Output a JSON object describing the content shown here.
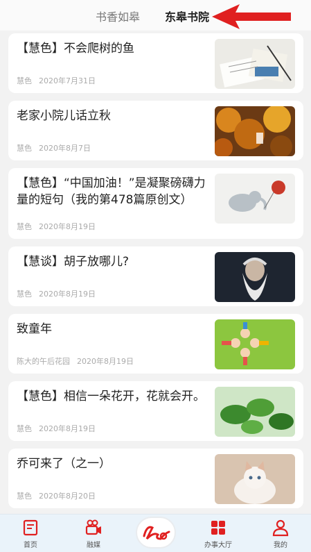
{
  "header": {
    "tabs": [
      {
        "label": "书香如皋"
      },
      {
        "label": "东皋书院"
      }
    ]
  },
  "articles": [
    {
      "title": "【慧色】不会爬树的鱼",
      "author": "慧色",
      "date": "2020年7月31日",
      "thumb": "notebook-photo"
    },
    {
      "title": "老家小院儿话立秋",
      "author": "慧色",
      "date": "2020年8月7日",
      "thumb": "autumn-leaves-photo"
    },
    {
      "title": "【慧色】“中国加油！”是凝聚磅礴力量的短句（我的第478篇原创文）",
      "author": "慧色",
      "date": "2020年8月19日",
      "thumb": "elephant-drawing"
    },
    {
      "title": "【慧谈】胡子放哪儿?",
      "author": "慧色",
      "date": "2020年8月19日",
      "thumb": "bearded-man-photo"
    },
    {
      "title": "致童年",
      "author": "陈大的午后花园",
      "date": "2020年8月19日",
      "thumb": "children-cartoon"
    },
    {
      "title": "【慧色】相信一朵花开，花就会开。",
      "author": "慧色",
      "date": "2020年8月19日",
      "thumb": "green-leaves-photo"
    },
    {
      "title": "乔可来了（之一）",
      "author": "慧色",
      "date": "2020年8月20日",
      "thumb": "kitten-photo"
    }
  ],
  "nav": {
    "items": [
      {
        "label": "首页",
        "icon": "home-icon"
      },
      {
        "label": "融媒",
        "icon": "video-camera-icon"
      },
      {
        "label": "办事大厅",
        "icon": "grid-icon"
      },
      {
        "label": "我的",
        "icon": "user-icon"
      }
    ],
    "center_icon": "app-logo-icon"
  },
  "colors": {
    "accent": "#e02020",
    "nav_bg": "#eaf3fa"
  }
}
